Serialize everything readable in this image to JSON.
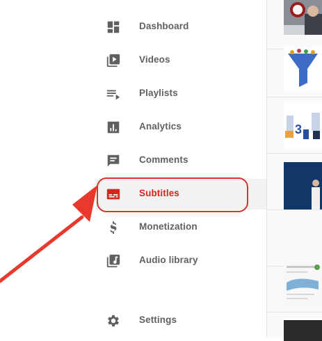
{
  "sidebar": {
    "items": [
      {
        "label": "Dashboard",
        "icon": "dashboard-icon"
      },
      {
        "label": "Videos",
        "icon": "videos-icon"
      },
      {
        "label": "Playlists",
        "icon": "playlists-icon"
      },
      {
        "label": "Analytics",
        "icon": "analytics-icon"
      },
      {
        "label": "Comments",
        "icon": "comments-icon"
      },
      {
        "label": "Subtitles",
        "icon": "subtitles-icon",
        "active": true
      },
      {
        "label": "Monetization",
        "icon": "monetization-icon"
      },
      {
        "label": "Audio library",
        "icon": "audio-library-icon"
      },
      {
        "label": "Settings",
        "icon": "settings-icon"
      }
    ]
  },
  "colors": {
    "icon": "#606060",
    "active": "#cc2b1d",
    "annotation": "#e8392c",
    "active_bg": "#f2f2f2"
  },
  "annotation": {
    "type": "arrow-and-outline",
    "target": "Subtitles"
  }
}
